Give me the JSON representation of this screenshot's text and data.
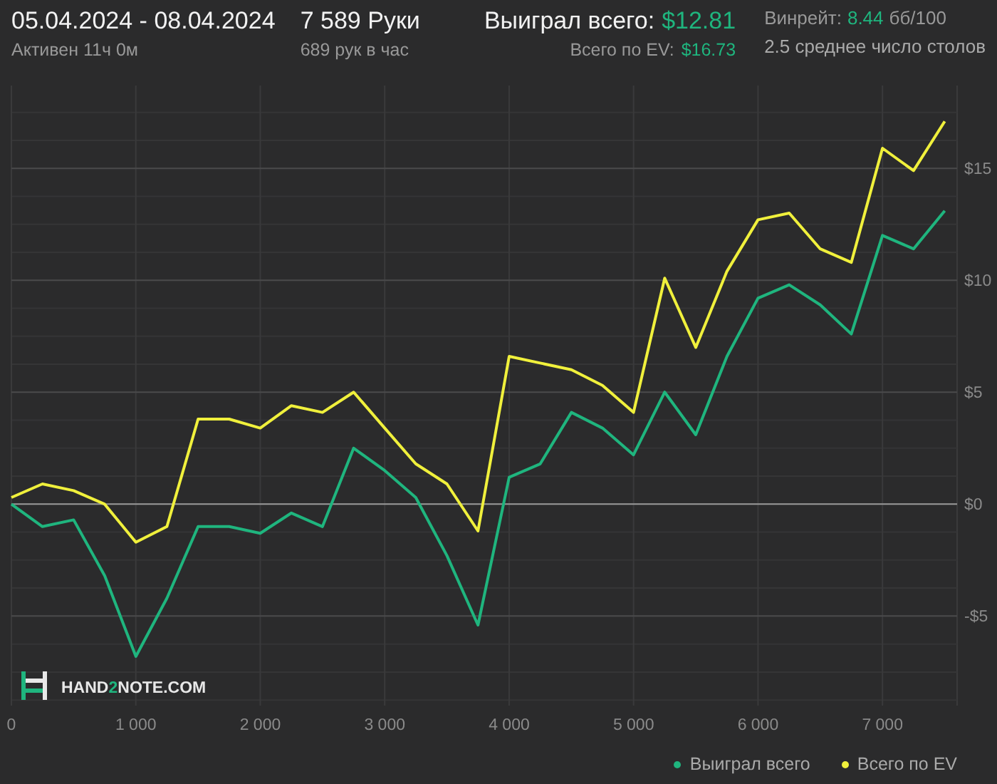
{
  "header": {
    "date_range": "05.04.2024 - 08.04.2024",
    "active_time": "Активен 11ч 0м",
    "hands": "7 589 Руки",
    "hands_per_hour": "689 рук в час",
    "won_label": "Выиграл всего:",
    "won_value": "$12.81",
    "ev_label": "Всего по EV:",
    "ev_value": "$16.73",
    "winrate_label": "Винрейт:",
    "winrate_value": "8.44",
    "winrate_unit": "бб/100",
    "tables": "2.5 среднее число столов"
  },
  "logo": {
    "parts": [
      "HAND",
      "2",
      "NOTE.COM"
    ]
  },
  "chart": {
    "chart_data": {
      "type": "line",
      "x": [
        0,
        250,
        500,
        750,
        1000,
        1250,
        1500,
        1750,
        2000,
        2250,
        2500,
        2750,
        3000,
        3250,
        3500,
        3750,
        4000,
        4250,
        4500,
        4750,
        5000,
        5250,
        5500,
        5750,
        6000,
        6250,
        6500,
        6750,
        7000,
        7250,
        7500
      ],
      "xlim": [
        0,
        7600
      ],
      "ylim": [
        -9,
        18.7
      ],
      "grid": true,
      "legend": true,
      "xticks": [
        {
          "value": 0,
          "label": "0"
        },
        {
          "value": 1000,
          "label": "1 000"
        },
        {
          "value": 2000,
          "label": "2 000"
        },
        {
          "value": 3000,
          "label": "3 000"
        },
        {
          "value": 4000,
          "label": "4 000"
        },
        {
          "value": 5000,
          "label": "5 000"
        },
        {
          "value": 6000,
          "label": "6 000"
        },
        {
          "value": 7000,
          "label": "7 000"
        }
      ],
      "yticks": [
        {
          "value": -5,
          "label": "-$5"
        },
        {
          "value": 0,
          "label": "$0"
        },
        {
          "value": 5,
          "label": "$5"
        },
        {
          "value": 10,
          "label": "$10"
        },
        {
          "value": 15,
          "label": "$15"
        }
      ],
      "series": [
        {
          "name": "Выиграл всего",
          "color": "#1fb57e",
          "values": [
            0,
            -1,
            -0.7,
            -3.2,
            -6.8,
            -4.2,
            -1,
            -1,
            -1.3,
            -0.4,
            -1,
            2.5,
            1.5,
            0.3,
            -2.3,
            -5.4,
            1.2,
            1.8,
            4.1,
            3.4,
            2.2,
            5,
            3.1,
            6.6,
            9.2,
            9.8,
            8.9,
            7.6,
            12,
            11.4,
            13.1
          ]
        },
        {
          "name": "Всего по EV",
          "color": "#f0f03c",
          "values": [
            0.3,
            0.9,
            0.6,
            0,
            -1.7,
            -1,
            3.8,
            3.8,
            3.4,
            4.4,
            4.1,
            5,
            3.4,
            1.8,
            0.9,
            -1.2,
            6.6,
            6.3,
            6,
            5.3,
            4.1,
            10.1,
            7,
            10.4,
            12.7,
            13,
            11.4,
            10.8,
            15.9,
            14.9,
            17.1
          ]
        }
      ]
    }
  }
}
